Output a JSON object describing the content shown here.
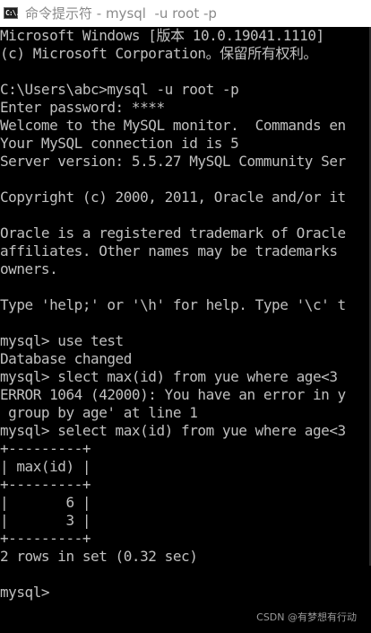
{
  "window": {
    "icon": "cmd-icon",
    "icon_text": "C:\\.",
    "title": "命令提示符 - mysql  -u root -p"
  },
  "console_lines": [
    "Microsoft Windows [版本 10.0.19041.1110]",
    "(c) Microsoft Corporation。保留所有权利。",
    "",
    "C:\\Users\\abc>mysql -u root -p",
    "Enter password: ****",
    "Welcome to the MySQL monitor.  Commands en",
    "Your MySQL connection id is 5",
    "Server version: 5.5.27 MySQL Community Ser",
    "",
    "Copyright (c) 2000, 2011, Oracle and/or it",
    "",
    "Oracle is a registered trademark of Oracle",
    "affiliates. Other names may be trademarks",
    "owners.",
    "",
    "Type 'help;' or '\\h' for help. Type '\\c' t",
    "",
    "mysql> use test",
    "Database changed",
    "mysql> slect max(id) from yue where age<3",
    "ERROR 1064 (42000): You have an error in y",
    " group by age' at line 1",
    "mysql> select max(id) from yue where age<3",
    "+---------+",
    "| max(id) |",
    "+---------+",
    "|       6 |",
    "|       3 |",
    "+---------+",
    "2 rows in set (0.32 sec)",
    "",
    "mysql>"
  ],
  "watermark": "CSDN @有梦想有行动",
  "colors": {
    "console_bg": "#000000",
    "console_text": "#c0c0c0",
    "titlebar_bg": "#ffffff",
    "title_text": "#8a8a8a"
  }
}
